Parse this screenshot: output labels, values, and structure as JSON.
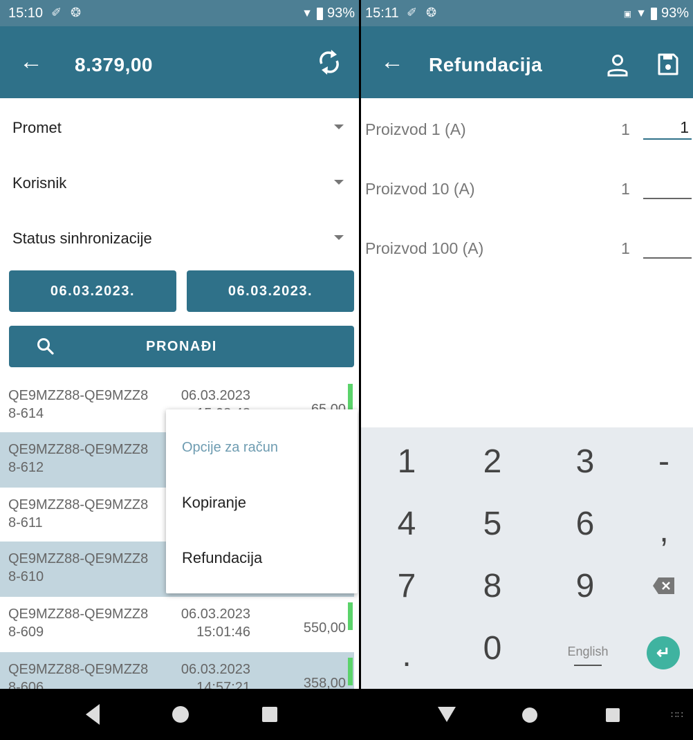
{
  "left": {
    "status": {
      "time": "15:10",
      "battery": "93%"
    },
    "toolbar": {
      "title": "8.379,00"
    },
    "filters": [
      {
        "label": "Promet"
      },
      {
        "label": "Korisnik"
      },
      {
        "label": "Status sinhronizacije"
      }
    ],
    "dates": {
      "from": "06.03.2023.",
      "to": "06.03.2023."
    },
    "search_label": "PRONAĐI",
    "rows": [
      {
        "id1": "QE9MZZ88-QE9MZZ8",
        "id2": "8-614",
        "date": "06.03.2023",
        "time": "15:08:48",
        "amount": "65,00"
      },
      {
        "id1": "QE9MZZ88-QE9MZZ8",
        "id2": "8-612",
        "date": "",
        "time": "",
        "amount": ""
      },
      {
        "id1": "QE9MZZ88-QE9MZZ8",
        "id2": "8-611",
        "date": "",
        "time": "",
        "amount": ""
      },
      {
        "id1": "QE9MZZ88-QE9MZZ8",
        "id2": "8-610",
        "date": "",
        "time": "",
        "amount": ""
      },
      {
        "id1": "QE9MZZ88-QE9MZZ8",
        "id2": "8-609",
        "date": "06.03.2023",
        "time": "15:01:46",
        "amount": "550,00"
      },
      {
        "id1": "QE9MZZ88-QE9MZZ8",
        "id2": "8-606",
        "date": "06.03.2023",
        "time": "14:57:21",
        "amount": "358,00"
      }
    ],
    "menu": {
      "header": "Opcije za račun",
      "items": [
        "Kopiranje",
        "Refundacija"
      ]
    }
  },
  "right": {
    "status": {
      "time": "15:11",
      "battery": "93%"
    },
    "toolbar": {
      "title": "Refundacija"
    },
    "products": [
      {
        "name": "Proizvod 1 (A)",
        "qty": "1",
        "value": "1"
      },
      {
        "name": "Proizvod 10 (A)",
        "qty": "1",
        "value": ""
      },
      {
        "name": "Proizvod 100 (A)",
        "qty": "1",
        "value": ""
      }
    ],
    "keyboard": {
      "keys": [
        "1",
        "2",
        "3",
        "-",
        "4",
        "5",
        "6",
        ",",
        "7",
        "8",
        "9"
      ],
      "dot": ".",
      "zero": "0",
      "lang": "English"
    }
  },
  "colors": {
    "primary": "#2f7189",
    "status_bar": "#4d7f94",
    "alt_row": "#c2d5de",
    "sync_ok": "#5bd36b",
    "enter": "#3fb3a0"
  }
}
